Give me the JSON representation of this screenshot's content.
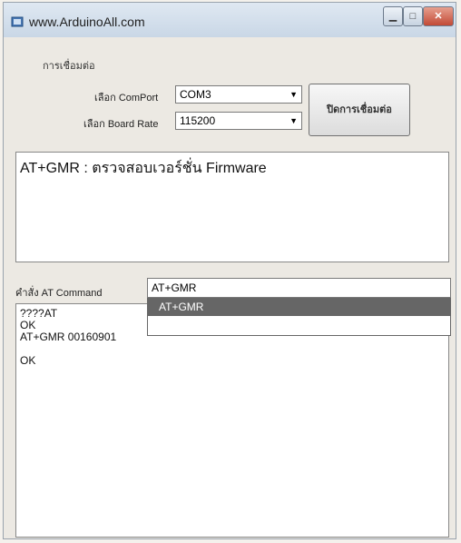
{
  "window": {
    "title": "www.ArduinoAll.com"
  },
  "connection": {
    "group_label": "การเชื่อมต่อ",
    "comport_label": "เลือก ComPort",
    "comport_value": "COM3",
    "baud_label": "เลือก Board Rate",
    "baud_value": "115200",
    "connect_button": "ปิดการเชื่อมต่อ"
  },
  "info_text": "AT+GMR : ตรวจสอบเวอร์ชั่น Firmware",
  "command": {
    "label": "คำสั่ง AT Command",
    "value": "AT+GMR",
    "dropdown_options": [
      "AT+GMR"
    ]
  },
  "output_lines": [
    "????AT",
    "OK",
    "AT+GMR 00160901",
    "",
    "OK"
  ],
  "icons": {
    "minimize": "minimize-icon",
    "maximize": "maximize-icon",
    "close": "close-icon",
    "dropdown": "chevron-down-icon"
  }
}
